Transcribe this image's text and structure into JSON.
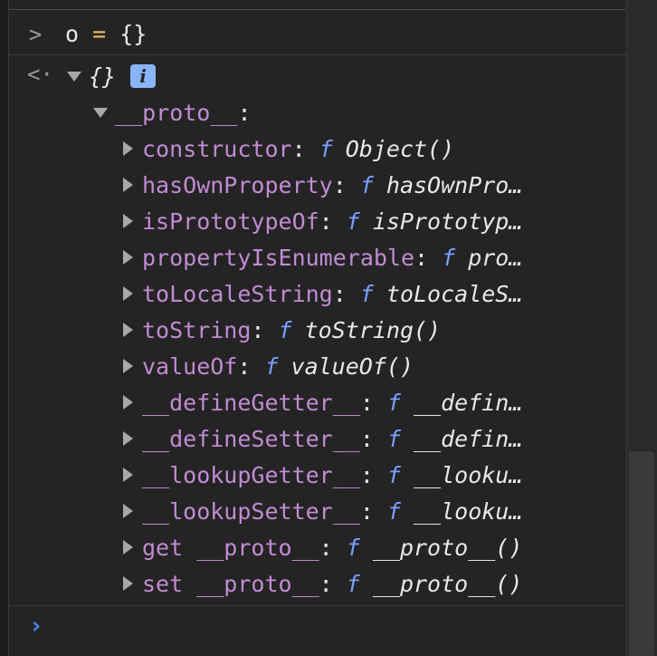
{
  "console": {
    "command": {
      "var": "o",
      "op": "=",
      "value": "{}"
    },
    "result": {
      "summary": "{}",
      "info_icon": "i"
    },
    "proto_label": "__proto__",
    "entries": [
      {
        "key": "constructor",
        "func": "Object()"
      },
      {
        "key": "hasOwnProperty",
        "func": "hasOwnPro…"
      },
      {
        "key": "isPrototypeOf",
        "func": "isPrototyp…"
      },
      {
        "key": "propertyIsEnumerable",
        "func": "pro…"
      },
      {
        "key": "toLocaleString",
        "func": "toLocaleS…"
      },
      {
        "key": "toString",
        "func": "toString()"
      },
      {
        "key": "valueOf",
        "func": "valueOf()"
      },
      {
        "key": "__defineGetter__",
        "func": "__defin…"
      },
      {
        "key": "__defineSetter__",
        "func": "__defin…"
      },
      {
        "key": "__lookupGetter__",
        "func": "__looku…"
      },
      {
        "key": "__lookupSetter__",
        "func": "__looku…"
      },
      {
        "key": "get __proto__",
        "func": "__proto__()"
      },
      {
        "key": "set __proto__",
        "func": "__proto__()"
      }
    ],
    "function_marker": "f",
    "input_prompt": "›",
    "colors": {
      "key": "#c28bd3",
      "function_marker": "#7aa0ff",
      "prompt": "#4d8cff",
      "info_badge": "#8ab4f8",
      "background": "#242424"
    }
  }
}
